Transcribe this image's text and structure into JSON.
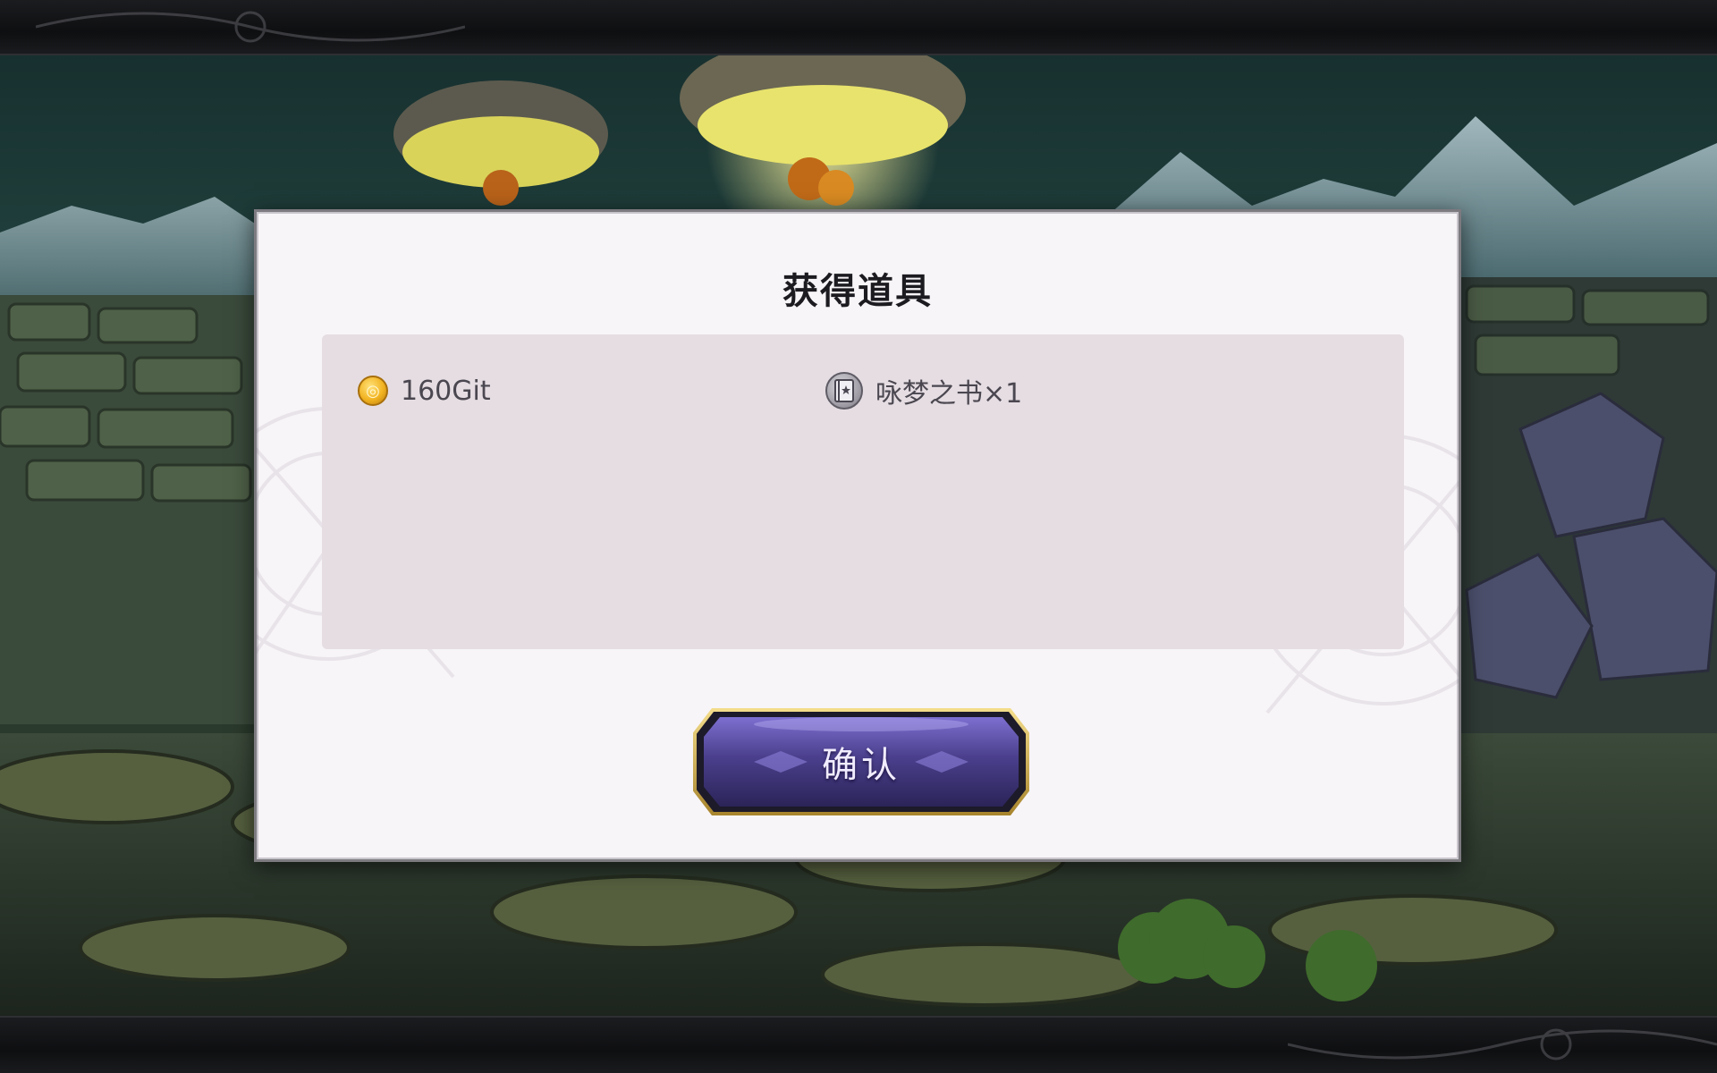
{
  "dialog": {
    "title": "获得道具"
  },
  "rewards": [
    {
      "icon": "gold-coin-icon",
      "label": "160Git"
    },
    {
      "icon": "book-icon",
      "label": "咏梦之书×1"
    }
  ],
  "buttons": {
    "confirm_label": "确认"
  },
  "colors": {
    "dialog_bg": "#f8f5f8",
    "panel_bg": "#e5dde2",
    "button_fill": "#4a3f8c",
    "button_border": "#d4b04c"
  }
}
